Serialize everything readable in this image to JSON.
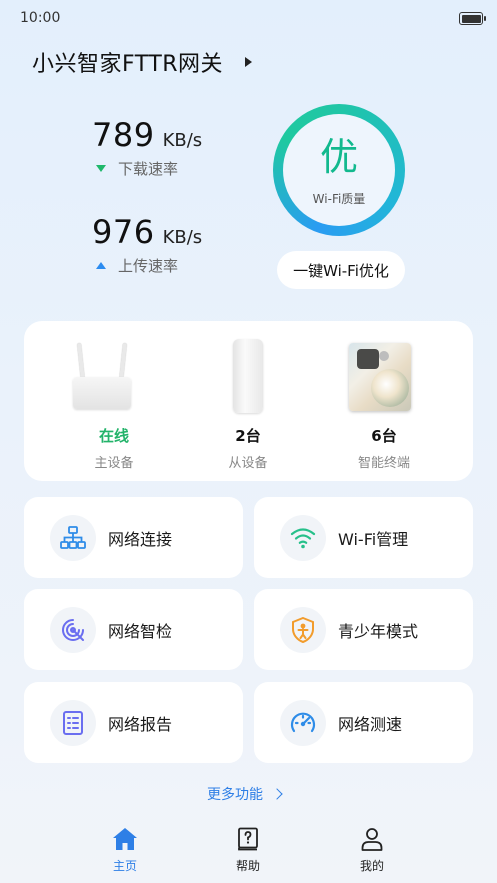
{
  "status_bar": {
    "time": "10:00",
    "battery_icon": "battery-full-icon"
  },
  "header": {
    "title": "小兴智家FTTR网关",
    "arrow_icon": "triangle-right-icon"
  },
  "download": {
    "value": "789",
    "unit": "KB/s",
    "label": "下载速率",
    "color": "#1fb86b"
  },
  "upload": {
    "value": "976",
    "unit": "KB/s",
    "label": "上传速率",
    "color": "#2c8cf0"
  },
  "wifi_quality": {
    "grade": "优",
    "label": "Wi-Fi质量",
    "color": "#12b98e"
  },
  "optimize_button": {
    "label": "一键Wi-Fi优化"
  },
  "devices": [
    {
      "status": "在线",
      "label": "主设备",
      "image": "router-image"
    },
    {
      "status": "2台",
      "label": "从设备",
      "image": "slave-unit-image"
    },
    {
      "status": "6台",
      "label": "智能终端",
      "image": "smartphone-image"
    }
  ],
  "functions": [
    {
      "label": "网络连接",
      "icon": "network-topology-icon"
    },
    {
      "label": "Wi-Fi管理",
      "icon": "wifi-icon"
    },
    {
      "label": "网络智检",
      "icon": "network-check-icon"
    },
    {
      "label": "青少年模式",
      "icon": "teen-mode-shield-icon"
    },
    {
      "label": "网络报告",
      "icon": "report-document-icon"
    },
    {
      "label": "网络测速",
      "icon": "speedometer-icon"
    }
  ],
  "more_link": {
    "label": "更多功能",
    "color": "#2e7fe6"
  },
  "tabs": [
    {
      "label": "主页",
      "icon": "home-icon",
      "active": true
    },
    {
      "label": "帮助",
      "icon": "help-book-icon",
      "active": false
    },
    {
      "label": "我的",
      "icon": "user-icon",
      "active": false
    }
  ]
}
